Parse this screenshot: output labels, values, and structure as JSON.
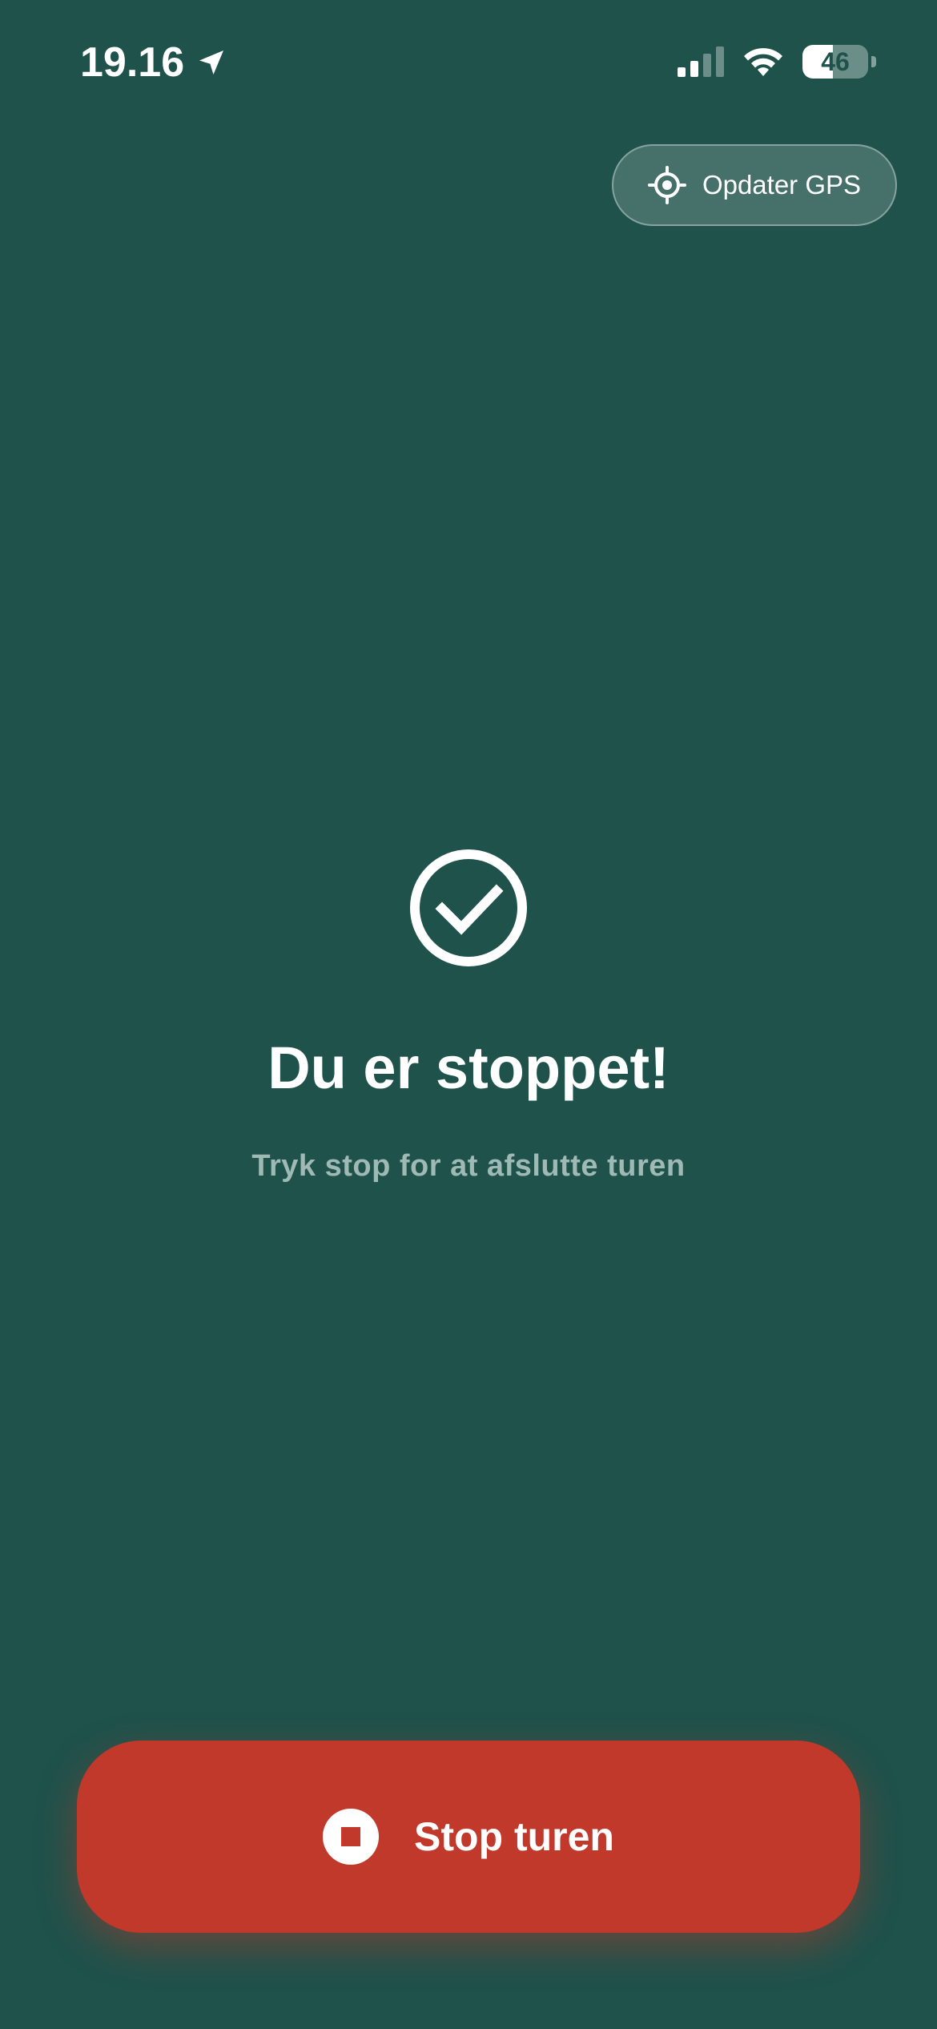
{
  "status_bar": {
    "time": "19.16",
    "battery_percent": "46",
    "battery_level": 0.46,
    "location_icon": "location-arrow-icon",
    "signal_icon": "cellular-signal-icon",
    "wifi_icon": "wifi-icon"
  },
  "gps_button": {
    "label": "Opdater GPS",
    "icon": "crosshair-icon"
  },
  "status": {
    "icon": "checkmark-circle-icon",
    "title": "Du er stoppet!",
    "subtitle": "Tryk stop for at afslutte turen"
  },
  "stop_button": {
    "label": "Stop turen",
    "icon": "stop-icon",
    "color": "#c0392b"
  },
  "colors": {
    "background": "#1e524b",
    "subtitle": "#9fbab5"
  }
}
